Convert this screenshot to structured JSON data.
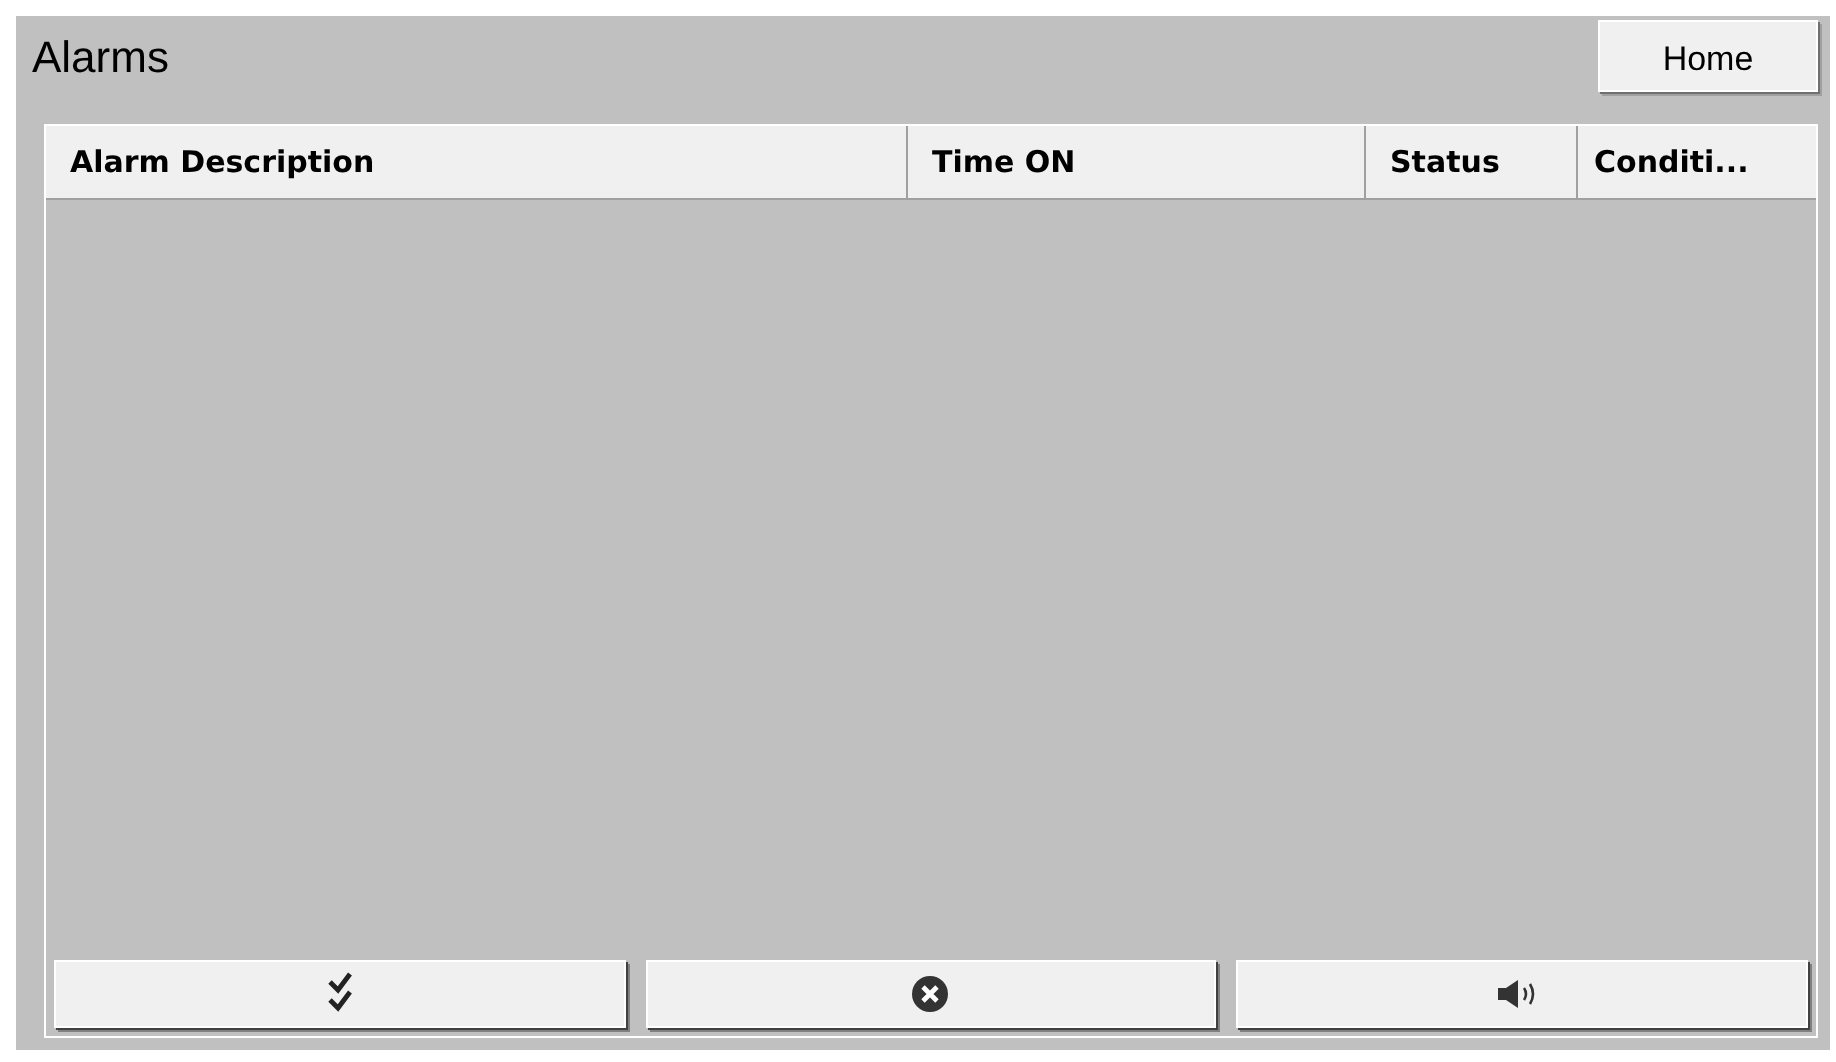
{
  "window": {
    "title": "Alarms"
  },
  "home_button": {
    "label": "Home"
  },
  "table": {
    "columns": [
      "Alarm Description",
      "Time ON",
      "Status",
      "Conditi..."
    ]
  },
  "footer_buttons": [
    {
      "kind": "ack"
    },
    {
      "kind": "clear"
    },
    {
      "kind": "silence"
    }
  ]
}
